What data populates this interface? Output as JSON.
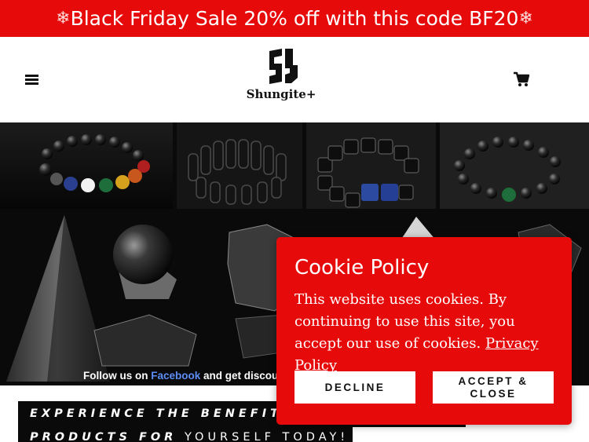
{
  "announcement": {
    "text": "Black Friday Sale 20% off with this code BF20",
    "snowflake": "❄"
  },
  "header": {
    "brand": "Shungite+",
    "menu_icon": "hamburger-menu-icon",
    "cart_icon": "shopping-cart-icon"
  },
  "hero": {
    "caption_pre": "Follow us on ",
    "caption_link": "Facebook",
    "caption_post": " and get discour"
  },
  "benefits": {
    "line1": "EXPERIENCE THE BENEFITS",
    "line2_bold": "PRODUCTS FOR",
    "line2_light": " YOURSELF TODAY!"
  },
  "cookie": {
    "title": "Cookie Policy",
    "body": "This website uses cookies. By continuing to use this site, you accept our use of cookies. ",
    "link": "Privacy Policy",
    "decline": "DECLINE",
    "accept": "ACCEPT & CLOSE"
  },
  "colors": {
    "brand_red": "#e60a0a",
    "black": "#0a0a0a",
    "link_blue": "#5b8df5"
  }
}
